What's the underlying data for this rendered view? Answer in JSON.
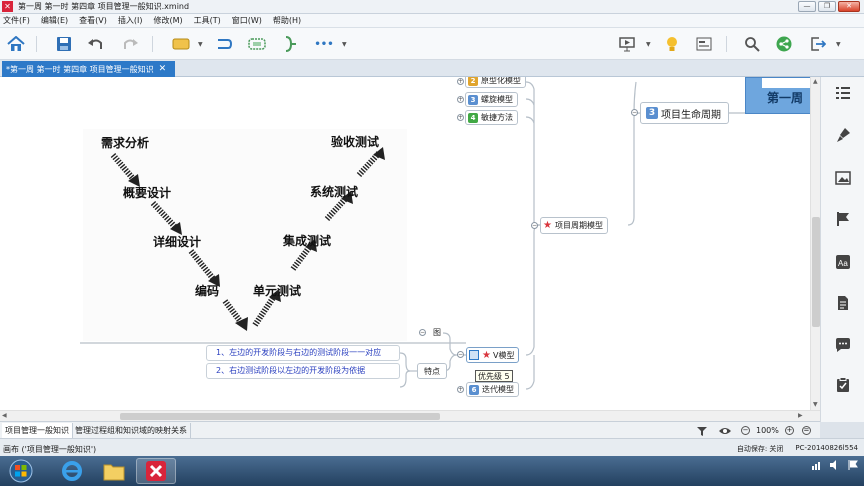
{
  "window": {
    "title": "第一周  第一时 第四章 项目管理一般知识.xmind",
    "logo_text": "✕",
    "controls": {
      "minimize": "—",
      "restore": "❐",
      "close": "✕"
    }
  },
  "menu": [
    "文件(F)",
    "编辑(E)",
    "查看(V)",
    "插入(I)",
    "修改(M)",
    "工具(T)",
    "窗口(W)",
    "帮助(H)"
  ],
  "toolbar": {
    "icons": [
      "home-icon",
      "save-icon",
      "undo-icon",
      "redo-icon",
      "topic-icon",
      "relationship-icon",
      "boundary-icon",
      "summary-icon",
      "more-icon",
      "presentation-icon",
      "idea-icon",
      "overview-icon",
      "search-icon",
      "share-icon",
      "export-icon"
    ],
    "more_label": "•••"
  },
  "tab": {
    "label": "*第一周  第一时 第四章 项目管理一般知识",
    "close": "✕"
  },
  "mindmap": {
    "nodes": [
      {
        "num": "2",
        "label": "原型化模型",
        "color": "#e0a42d"
      },
      {
        "num": "3",
        "label": "螺旋模型",
        "color": "#5a8fd0"
      },
      {
        "num": "4",
        "label": "敏捷方法",
        "color": "#41a844"
      },
      {
        "label": "项目周期模型",
        "icon": "★"
      },
      {
        "num": "3",
        "label": "项目生命周期",
        "color": "#5a8fd0"
      },
      {
        "label": "V模型",
        "icon": "★"
      },
      {
        "num": "6",
        "label": "迭代模型",
        "color": "#5a8fd0"
      },
      {
        "label": "第一周"
      }
    ],
    "image_label": "图",
    "trait_label": "特点",
    "traits": [
      "1、左边的开发阶段与右边的测试阶段一一对应",
      "2、右边测试阶段以左边的开发阶段为依据"
    ],
    "priority_tooltip": "优先级 5",
    "v_image_labels": [
      "需求分析",
      "概要设计",
      "详细设计",
      "编码",
      "单元测试",
      "集成测试",
      "系统测试",
      "验收测试"
    ]
  },
  "sheets": [
    "项目管理一般知识",
    "管理过程组和知识域的映射关系"
  ],
  "zoom": {
    "level": "100%",
    "minus": "−",
    "plus": "+"
  },
  "status": {
    "left": "画布 ('项目管理一般知识')",
    "autosave": "自动保存: 关闭",
    "machine": "PC-20140826l554"
  },
  "colors": {
    "accent": "#2d79c8",
    "taskbar": "#23405f"
  }
}
